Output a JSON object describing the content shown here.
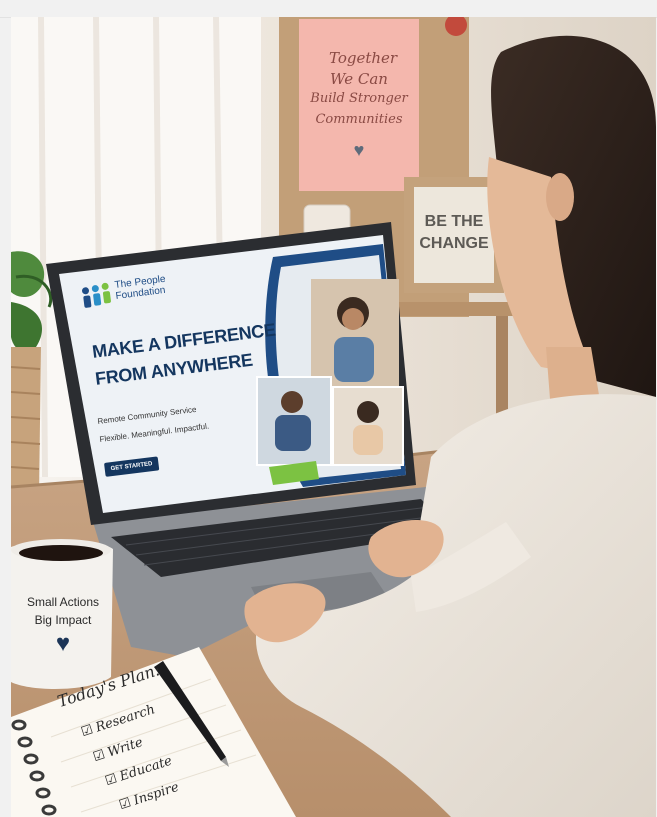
{
  "poster": {
    "lines": [
      "Together",
      "We Can",
      "Build Stronger",
      "Communities"
    ],
    "heart": "♥"
  },
  "sign": {
    "lines": [
      "BE THE",
      "CHANGE"
    ]
  },
  "laptop_screen": {
    "brand_line1": "The People",
    "brand_line2": "Foundation",
    "headline_line1": "MAKE A DIFFERENCE",
    "headline_line2": "FROM ANYWHERE",
    "subtitle": "Remote Community Service",
    "tagline": "Flexible. Meaningful. Impactful.",
    "cta_label": "GET STARTED"
  },
  "mug": {
    "line1": "Small Actions",
    "line2": "Big Impact",
    "heart": "♥"
  },
  "notebook": {
    "title": "Today's Plan:",
    "items": [
      "Research",
      "Write",
      "Educate",
      "Inspire"
    ],
    "checkbox": "☑"
  },
  "colors": {
    "screen_blue": "#1f4d86",
    "cta_blue": "#14365f",
    "accent_green": "#7cc242",
    "poster_pink": "#f4b7ad",
    "heart_navy": "#1c3557"
  }
}
